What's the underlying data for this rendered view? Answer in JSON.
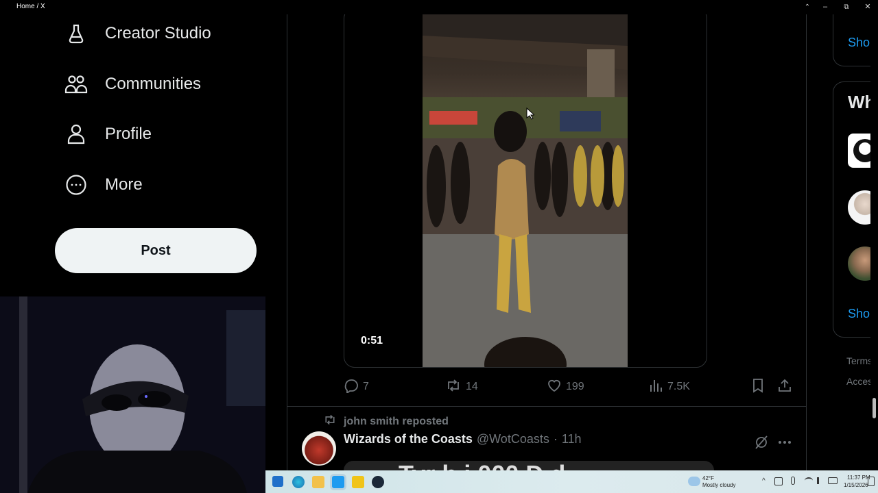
{
  "window": {
    "title": "Home / X",
    "controls": [
      "–",
      "⧉",
      "✕"
    ],
    "tabs_caret": "⌃"
  },
  "nav": {
    "items": [
      {
        "label": "Creator Studio",
        "icon": "flask-icon"
      },
      {
        "label": "Communities",
        "icon": "people-icon"
      },
      {
        "label": "Profile",
        "icon": "person-icon"
      },
      {
        "label": "More",
        "icon": "more-circle-icon"
      }
    ],
    "post_label": "Post"
  },
  "video_post": {
    "duration": "0:51",
    "actions": {
      "replies": "7",
      "reposts": "14",
      "likes": "199",
      "views": "7.5K"
    }
  },
  "next_post": {
    "repost_text": "john smith reposted",
    "author_name": "Wizards of the Coasts",
    "handle": "@WotCoasts",
    "separator": "·",
    "time": "11h",
    "media_text": "Tyr     h  i  000 D  d"
  },
  "right": {
    "show_more_top": "Sho",
    "who_to_follow": "Wh",
    "show_more_bottom": "Sho",
    "footer": [
      "Terms",
      "Acces"
    ]
  },
  "taskbar": {
    "weather_temp": "42°F",
    "weather_text": "Mostly cloudy",
    "time": "11:37 PM",
    "date": "1/15/2026"
  }
}
